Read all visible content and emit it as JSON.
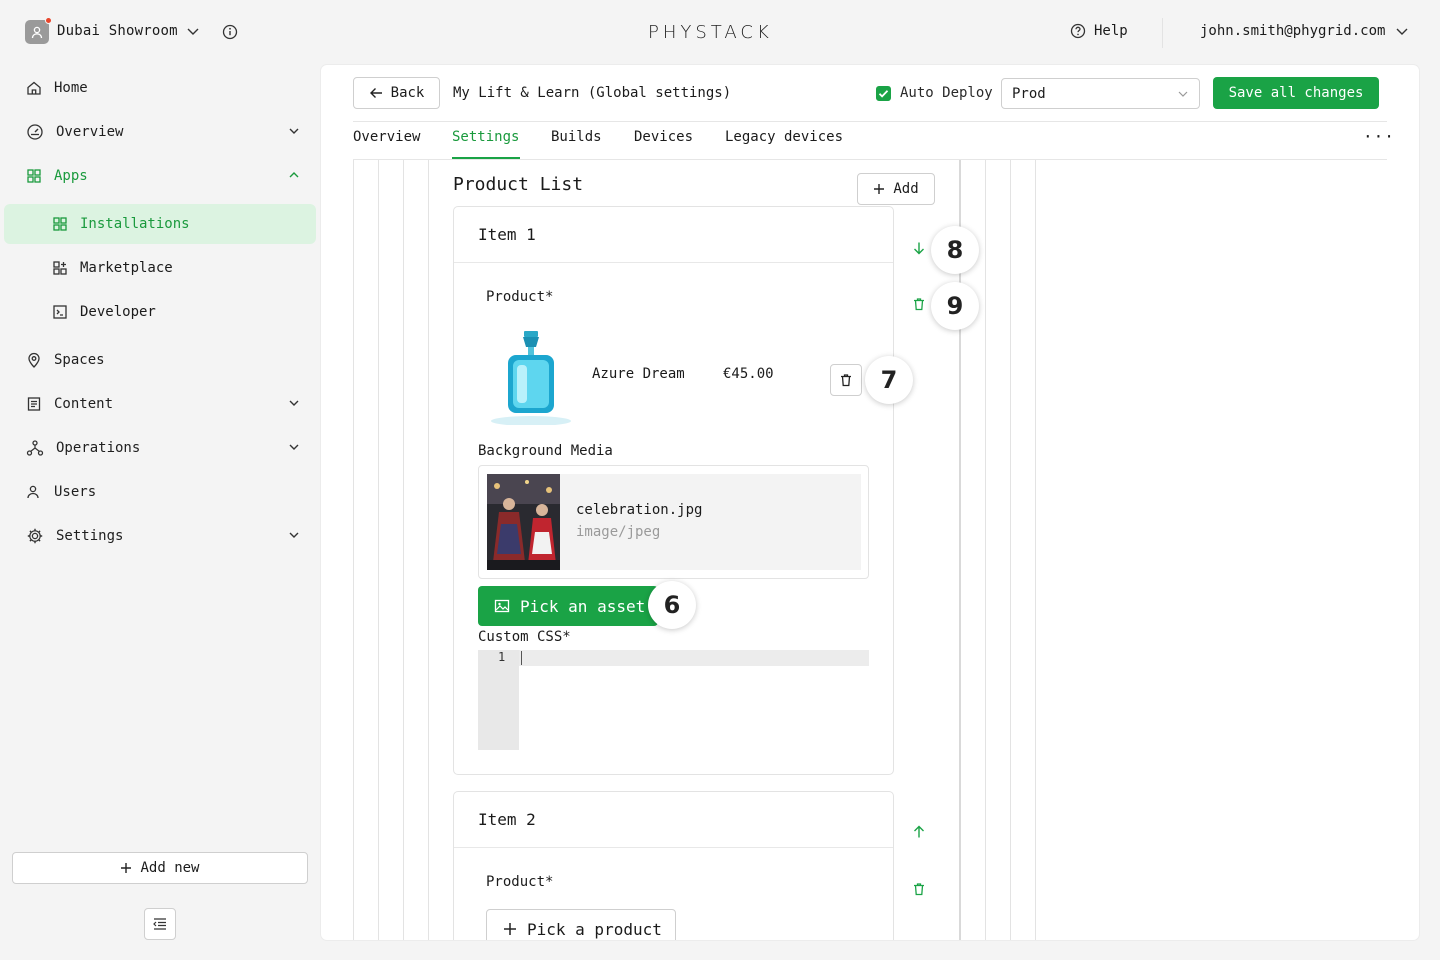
{
  "workspace": {
    "name": "Dubai Showroom"
  },
  "brand": {
    "logo": "PHYSTACK"
  },
  "header": {
    "help": "Help",
    "user_email": "john.smith@phygrid.com"
  },
  "sidebar": {
    "items": [
      {
        "label": "Home",
        "icon": "home-icon"
      },
      {
        "label": "Overview",
        "icon": "gauge-icon"
      },
      {
        "label": "Apps",
        "icon": "grid-icon"
      },
      {
        "label": "Installations",
        "icon": "grid-icon"
      },
      {
        "label": "Marketplace",
        "icon": "apps-add-icon"
      },
      {
        "label": "Developer",
        "icon": "terminal-icon"
      },
      {
        "label": "Spaces",
        "icon": "location-pin-icon"
      },
      {
        "label": "Content",
        "icon": "document-icon"
      },
      {
        "label": "Operations",
        "icon": "network-icon"
      },
      {
        "label": "Users",
        "icon": "users-icon"
      },
      {
        "label": "Settings",
        "icon": "gear-icon"
      }
    ],
    "add_new": "Add new"
  },
  "toolbar": {
    "back": "Back",
    "app_title": "My Lift & Learn (Global settings)",
    "auto_deploy": "Auto Deploy",
    "auto_deploy_checked": true,
    "environment": "Prod",
    "save": "Save all changes"
  },
  "tabs": [
    {
      "label": "Overview",
      "active": false
    },
    {
      "label": "Settings",
      "active": true
    },
    {
      "label": "Builds",
      "active": false
    },
    {
      "label": "Devices",
      "active": false
    },
    {
      "label": "Legacy devices",
      "active": false
    }
  ],
  "product_list": {
    "title": "Product List",
    "add": "Add",
    "items": [
      {
        "title": "Item 1",
        "product_label": "Product*",
        "product_name": "Azure Dream",
        "product_price": "€45.00",
        "background_media_label": "Background Media",
        "media_filename": "celebration.jpg",
        "media_type": "image/jpeg",
        "pick_asset": "Pick an asset",
        "custom_css_label": "Custom CSS*",
        "css_line_number": "1"
      },
      {
        "title": "Item 2",
        "product_label": "Product*",
        "pick_product": "Pick a product"
      }
    ]
  },
  "annotations": [
    "6",
    "7",
    "8",
    "9"
  ],
  "colors": {
    "accent": "#1aa346",
    "active_bg": "#dcf3e1",
    "background": "#f4f4f4"
  }
}
